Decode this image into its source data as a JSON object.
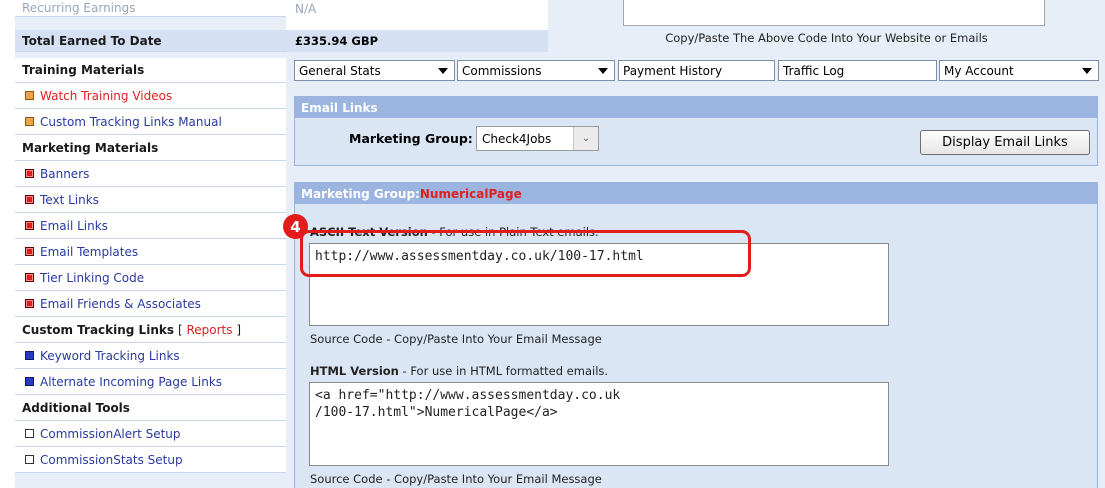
{
  "summary": {
    "recurring_label": "Recurring Earnings",
    "recurring_value": "N/A",
    "total_label": "Total Earned To Date",
    "total_value": "£335.94 GBP",
    "copy_paste_note": "Copy/Paste The Above Code Into Your Website or Emails"
  },
  "sidebar": {
    "training_header": "Training Materials",
    "watch_videos": "Watch Training Videos",
    "tracking_manual": "Custom Tracking Links Manual",
    "marketing_header": "Marketing Materials",
    "banners": "Banners",
    "text_links": "Text Links",
    "email_links": "Email Links",
    "email_templates": "Email Templates",
    "tier_linking": "Tier Linking Code",
    "email_friends": "Email Friends & Associates",
    "custom_tracking_header": "Custom Tracking Links",
    "reports_link": "Reports",
    "keyword_tracking": "Keyword Tracking Links",
    "alternate_incoming": "Alternate Incoming Page Links",
    "additional_header": "Additional Tools",
    "commission_alert": "CommissionAlert Setup",
    "commission_stats": "CommissionStats Setup"
  },
  "tabs": {
    "general_stats": "General Stats",
    "commissions": "Commissions",
    "payment_history": "Payment History",
    "traffic_log": "Traffic Log",
    "my_account": "My Account"
  },
  "email_links_panel": {
    "title": "Email Links",
    "marketing_group_label": "Marketing Group:",
    "marketing_group_value": "Check4Jobs",
    "display_button": "Display Email Links"
  },
  "group_panel": {
    "title_prefix": "Marketing Group: ",
    "title_group": "NumericalPage",
    "step_badge": "4",
    "ascii_label": "ASCII Text Version",
    "ascii_desc": " - For use in Plain Text emails.",
    "ascii_code": "http://www.assessmentday.co.uk/100-17.html",
    "source_note_1": "Source Code - Copy/Paste Into Your Email Message",
    "html_label": "HTML Version",
    "html_desc": " - For use in HTML formatted emails.",
    "html_code": "<a href=\"http://www.assessmentday.co.uk\n/100-17.html\">NumericalPage</a>",
    "source_note_2": "Source Code - Copy/Paste Into Your Email Message"
  }
}
